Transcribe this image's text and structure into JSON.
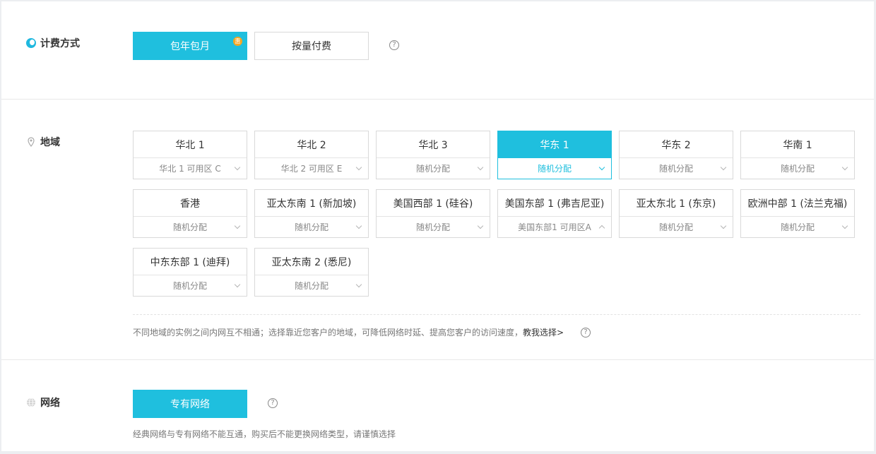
{
  "billing": {
    "label": "计费方式",
    "options": [
      {
        "label": "包年包月",
        "badge": "惠",
        "active": true
      },
      {
        "label": "按量付费",
        "active": false
      }
    ],
    "help": "?"
  },
  "region": {
    "label": "地域",
    "cards": [
      {
        "name": "华北 1",
        "zone": "华北 1 可用区 C",
        "selected": false
      },
      {
        "name": "华北 2",
        "zone": "华北 2 可用区 E",
        "selected": false
      },
      {
        "name": "华北 3",
        "zone": "随机分配",
        "selected": false
      },
      {
        "name": "华东 1",
        "zone": "随机分配",
        "selected": true
      },
      {
        "name": "华东 2",
        "zone": "随机分配",
        "selected": false
      },
      {
        "name": "华南 1",
        "zone": "随机分配",
        "selected": false
      },
      {
        "name": "香港",
        "zone": "随机分配",
        "selected": false
      },
      {
        "name": "亚太东南 1 (新加坡)",
        "zone": "随机分配",
        "selected": false
      },
      {
        "name": "美国西部 1 (硅谷)",
        "zone": "随机分配",
        "selected": false
      },
      {
        "name": "美国东部 1 (弗吉尼亚)",
        "zone": "美国东部1 可用区A",
        "selected": false,
        "open": true
      },
      {
        "name": "亚太东北 1 (东京)",
        "zone": "随机分配",
        "selected": false
      },
      {
        "name": "欧洲中部 1 (法兰克福)",
        "zone": "随机分配",
        "selected": false
      },
      {
        "name": "中东东部 1 (迪拜)",
        "zone": "随机分配",
        "selected": false
      },
      {
        "name": "亚太东南 2 (悉尼)",
        "zone": "随机分配",
        "selected": false
      }
    ],
    "note": "不同地域的实例之间内网互不相通；选择靠近您客户的地域，可降低网络时延、提高您客户的访问速度，",
    "note_link": "教我选择>",
    "help": "?"
  },
  "network": {
    "label": "网络",
    "option": "专有网络",
    "help": "?",
    "note": "经典网络与专有网络不能互通，购买后不能更换网络类型，请谨慎选择"
  },
  "colors": {
    "accent": "#1fbfde",
    "badge": "#f5a623",
    "border": "#d9d9d9"
  },
  "icons": {
    "billing": "billing-icon",
    "region": "location-pin-icon",
    "network": "globe-icon",
    "help": "question-circle-icon",
    "dropdown": "chevron-down-icon"
  }
}
